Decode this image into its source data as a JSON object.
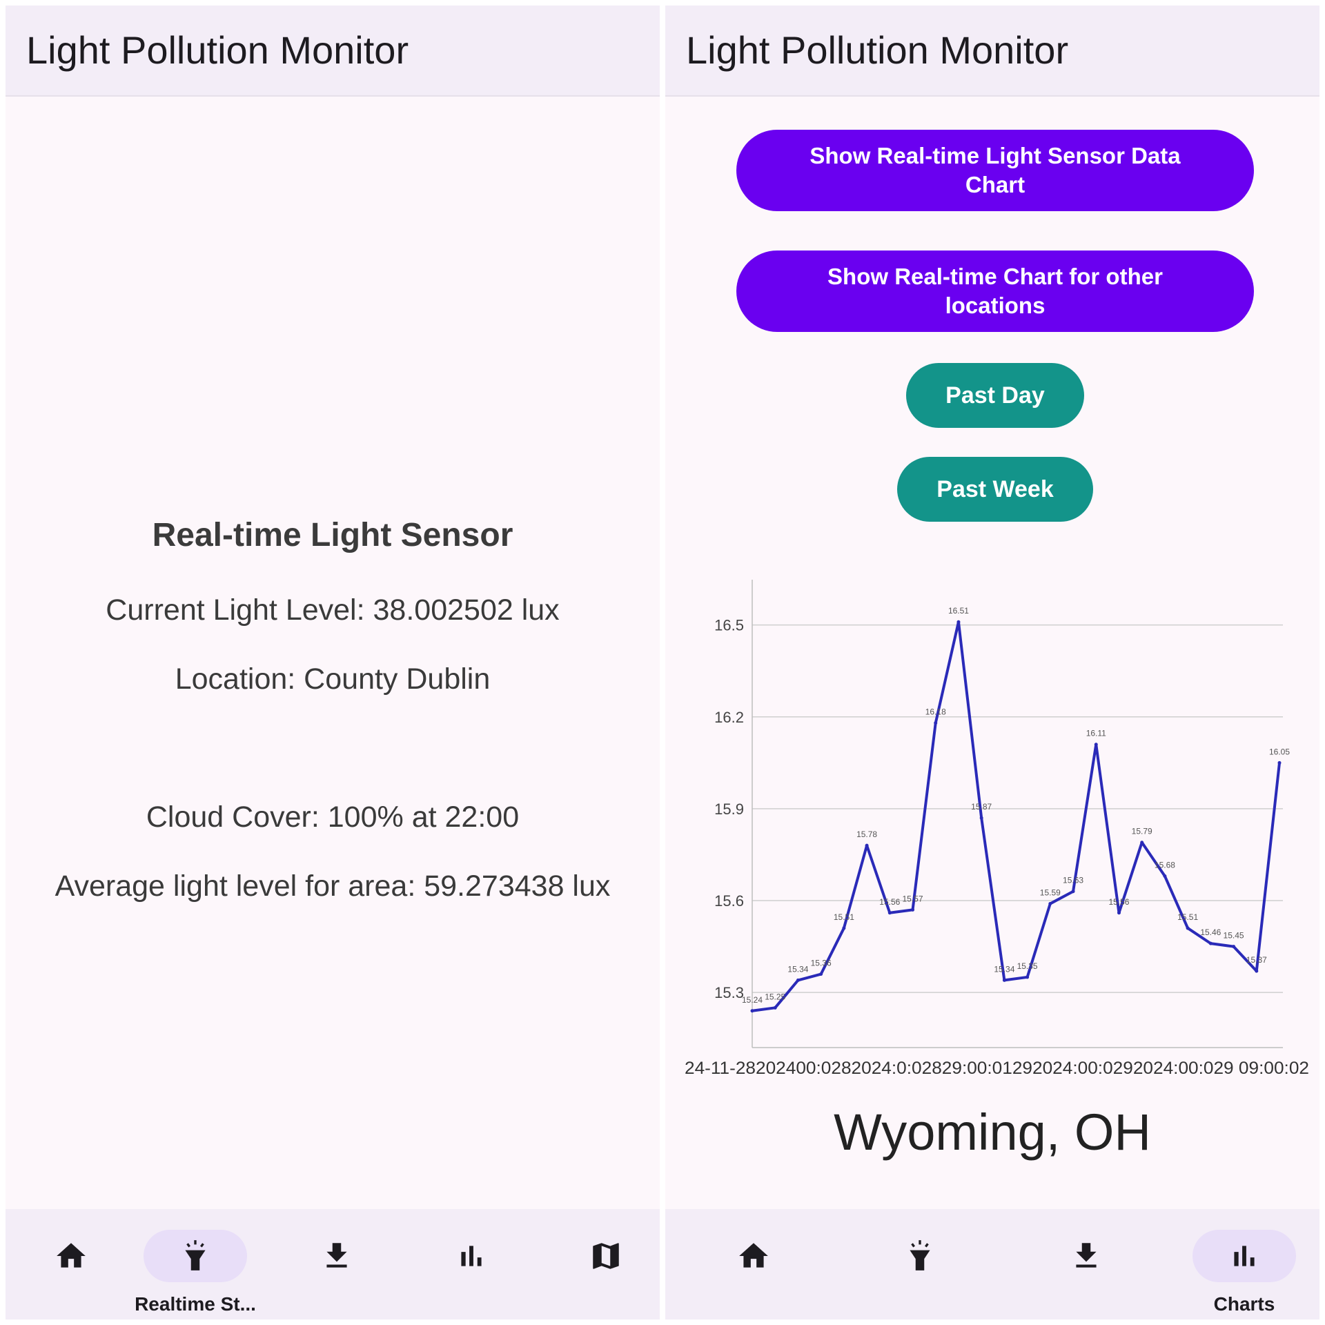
{
  "app_title": "Light Pollution Monitor",
  "sensor": {
    "heading": "Real-time Light Sensor",
    "current_level": "Current Light Level: 38.002502 lux",
    "location": "Location: County Dublin",
    "cloud_cover": "Cloud Cover: 100% at 22:00",
    "average_level": "Average light level for area: 59.273438 lux"
  },
  "charts_screen": {
    "btn_realtime_sensor": "Show Real-time Light Sensor Data Chart",
    "btn_other_locations": "Show Real-time Chart for other locations",
    "btn_past_day": "Past Day",
    "btn_past_week": "Past Week",
    "location_title": "Wyoming, OH"
  },
  "nav_left": {
    "items": [
      {
        "icon": "home-icon",
        "label": ""
      },
      {
        "icon": "flashlight-icon",
        "label": "Realtime St..."
      },
      {
        "icon": "download-icon",
        "label": ""
      },
      {
        "icon": "bar-chart-icon",
        "label": ""
      },
      {
        "icon": "map-icon",
        "label": ""
      }
    ],
    "selected": 1
  },
  "nav_right": {
    "items": [
      {
        "icon": "home-icon",
        "label": ""
      },
      {
        "icon": "flashlight-icon",
        "label": ""
      },
      {
        "icon": "download-icon",
        "label": ""
      },
      {
        "icon": "bar-chart-icon",
        "label": "Charts"
      }
    ],
    "selected": 3
  },
  "colors": {
    "primary_button": "#6a00f0",
    "teal_button": "#13948a",
    "line": "#2a2ab8",
    "nav_pill": "#e8def8"
  },
  "chart_data": {
    "type": "line",
    "title": "",
    "xlabel": "",
    "ylabel": "",
    "ylim": [
      15.12,
      16.63
    ],
    "yticks": [
      15.3,
      15.6,
      15.9,
      16.2,
      16.5
    ],
    "grid": true,
    "x_tick_text": "24-11-2024 00:02 ... 2024-00:02 ... 29 09:00:02",
    "x_axis_label_text": "24-11-28202400:0282024:0:02829:00:01292024:00:0292024:00:029 09:00:02",
    "series": [
      {
        "values": [
          15.24,
          15.25,
          15.34,
          15.36,
          15.51,
          15.78,
          15.56,
          15.57,
          16.18,
          16.51,
          15.87,
          15.34,
          15.35,
          15.59,
          15.63,
          16.11,
          15.56,
          15.79,
          15.68,
          15.51,
          15.46,
          15.45,
          15.37,
          16.05
        ],
        "labels": [
          "15.24",
          "15.25",
          "15.34",
          "15.36",
          "15.51",
          "15.78",
          "15.56",
          "15.57",
          "16.18",
          "16.51",
          "15.87",
          "15.34",
          "15.35",
          "15.59",
          "15.63",
          "16.11",
          "15.56",
          "15.79",
          "15.68",
          "15.51",
          "15.46",
          "15.45",
          "15.37",
          "16.05"
        ]
      }
    ]
  }
}
